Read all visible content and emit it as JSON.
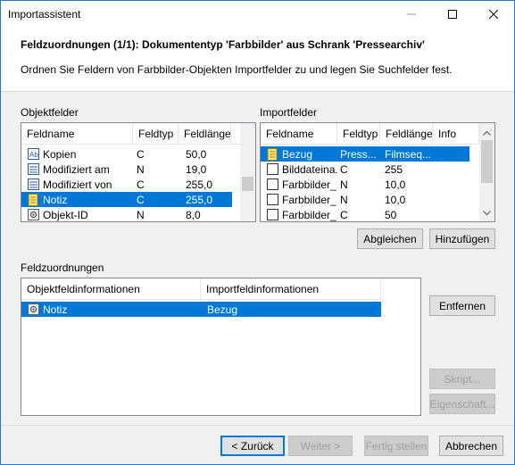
{
  "window": {
    "title": "Importassistent"
  },
  "header": {
    "title": "Feldzuordnungen (1/1): Dokumententyp 'Farbbilder' aus Schrank 'Pressearchiv'",
    "description": "Ordnen Sie Feldern von Farbbilder-Objekten Importfelder zu und legen Sie Suchfelder fest."
  },
  "objektfelder": {
    "label": "Objektfelder",
    "columns": [
      "Feldname",
      "Feldtyp",
      "Feldlänge"
    ],
    "rows": [
      {
        "icon": "text-field-icon",
        "name": "Kopien",
        "type": "C",
        "length": "50,0"
      },
      {
        "icon": "date-field-icon",
        "name": "Modifiziert am",
        "type": "N",
        "length": "19,0"
      },
      {
        "icon": "date-field-icon",
        "name": "Modifiziert von",
        "type": "C",
        "length": "255,0"
      },
      {
        "icon": "note-icon",
        "name": "Notiz",
        "type": "C",
        "length": "255,0"
      },
      {
        "icon": "id-field-icon",
        "name": "Objekt-ID",
        "type": "N",
        "length": "8,0"
      }
    ],
    "selected_index": 3
  },
  "importfelder": {
    "label": "Importfelder",
    "columns": [
      "Feldname",
      "Feldtyp",
      "Feldlänge",
      "Info"
    ],
    "rows": [
      {
        "icon": "note-icon",
        "name": "Bezug",
        "type": "Press...",
        "length": "Filmseq..."
      },
      {
        "icon": "checkbox-icon",
        "name": "Bilddateina...",
        "type": "C",
        "length": "255"
      },
      {
        "icon": "checkbox-icon",
        "name": "Farbbilder_...",
        "type": "N",
        "length": "10,0"
      },
      {
        "icon": "checkbox-icon",
        "name": "Farbbilder_...",
        "type": "N",
        "length": "10,0"
      },
      {
        "icon": "checkbox-icon",
        "name": "Farbbilder_...",
        "type": "C",
        "length": "50"
      }
    ],
    "selected_index": 0
  },
  "buttons": {
    "abgleichen": "Abgleichen",
    "hinzufuegen": "Hinzufügen",
    "entfernen": "Entfernen",
    "skript": "Skript...",
    "eigenschaften": "Eigenschaft...",
    "zurueck": "< Zurück",
    "weiter": "Weiter >",
    "fertig": "Fertig stellen",
    "abbrechen": "Abbrechen"
  },
  "zuordnungen": {
    "label": "Feldzuordnungen",
    "columns": [
      "Objektfeldinformationen",
      "Importfeldinformationen"
    ],
    "rows": [
      {
        "icon": "id-field-icon",
        "object_field": "Notiz",
        "import_field": "Bezug"
      }
    ]
  },
  "colors": {
    "selection": "#0078d7",
    "accent_border": "#0078d7"
  }
}
